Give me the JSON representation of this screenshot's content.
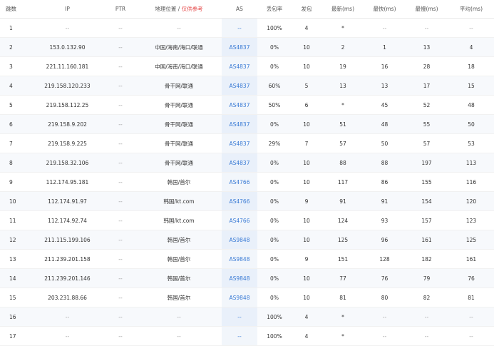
{
  "headers": {
    "hop": "跳数",
    "ip": "IP",
    "ptr": "PTR",
    "geo": "地理位置",
    "geo_sep": " / ",
    "geo_note": "仅供参考",
    "as": "AS",
    "loss": "丢包率",
    "sent": "发包",
    "last": "最新(ms)",
    "best": "最快(ms)",
    "worst": "最慢(ms)",
    "avg": "平均(ms)"
  },
  "rows": [
    {
      "hop": "1",
      "ip": "--",
      "ptr": "--",
      "geo": "--",
      "as": "--",
      "loss": "100%",
      "sent": "4",
      "last": "*",
      "best": "--",
      "worst": "--",
      "avg": "--"
    },
    {
      "hop": "2",
      "ip": "153.0.132.90",
      "ptr": "--",
      "geo": "中国/海南/海口/联通",
      "as": "AS4837",
      "loss": "0%",
      "sent": "10",
      "last": "2",
      "best": "1",
      "worst": "13",
      "avg": "4"
    },
    {
      "hop": "3",
      "ip": "221.11.160.181",
      "ptr": "--",
      "geo": "中国/海南/海口/联通",
      "as": "AS4837",
      "loss": "0%",
      "sent": "10",
      "last": "19",
      "best": "16",
      "worst": "28",
      "avg": "18"
    },
    {
      "hop": "4",
      "ip": "219.158.120.233",
      "ptr": "--",
      "geo": "骨干网/联通",
      "as": "AS4837",
      "loss": "60%",
      "sent": "5",
      "last": "13",
      "best": "13",
      "worst": "17",
      "avg": "15"
    },
    {
      "hop": "5",
      "ip": "219.158.112.25",
      "ptr": "--",
      "geo": "骨干网/联通",
      "as": "AS4837",
      "loss": "50%",
      "sent": "6",
      "last": "*",
      "best": "45",
      "worst": "52",
      "avg": "48"
    },
    {
      "hop": "6",
      "ip": "219.158.9.202",
      "ptr": "--",
      "geo": "骨干网/联通",
      "as": "AS4837",
      "loss": "0%",
      "sent": "10",
      "last": "51",
      "best": "48",
      "worst": "55",
      "avg": "50"
    },
    {
      "hop": "7",
      "ip": "219.158.9.225",
      "ptr": "--",
      "geo": "骨干网/联通",
      "as": "AS4837",
      "loss": "29%",
      "sent": "7",
      "last": "57",
      "best": "50",
      "worst": "57",
      "avg": "53"
    },
    {
      "hop": "8",
      "ip": "219.158.32.106",
      "ptr": "--",
      "geo": "骨干网/联通",
      "as": "AS4837",
      "loss": "0%",
      "sent": "10",
      "last": "88",
      "best": "88",
      "worst": "197",
      "avg": "113"
    },
    {
      "hop": "9",
      "ip": "112.174.95.181",
      "ptr": "--",
      "geo": "韩国/首尔",
      "as": "AS4766",
      "loss": "0%",
      "sent": "10",
      "last": "117",
      "best": "86",
      "worst": "155",
      "avg": "116"
    },
    {
      "hop": "10",
      "ip": "112.174.91.97",
      "ptr": "--",
      "geo": "韩国/kt.com",
      "as": "AS4766",
      "loss": "0%",
      "sent": "9",
      "last": "91",
      "best": "91",
      "worst": "154",
      "avg": "120"
    },
    {
      "hop": "11",
      "ip": "112.174.92.74",
      "ptr": "--",
      "geo": "韩国/kt.com",
      "as": "AS4766",
      "loss": "0%",
      "sent": "10",
      "last": "124",
      "best": "93",
      "worst": "157",
      "avg": "123"
    },
    {
      "hop": "12",
      "ip": "211.115.199.106",
      "ptr": "--",
      "geo": "韩国/首尔",
      "as": "AS9848",
      "loss": "0%",
      "sent": "10",
      "last": "125",
      "best": "96",
      "worst": "161",
      "avg": "125"
    },
    {
      "hop": "13",
      "ip": "211.239.201.158",
      "ptr": "--",
      "geo": "韩国/首尔",
      "as": "AS9848",
      "loss": "0%",
      "sent": "9",
      "last": "151",
      "best": "128",
      "worst": "182",
      "avg": "161"
    },
    {
      "hop": "14",
      "ip": "211.239.201.146",
      "ptr": "--",
      "geo": "韩国/首尔",
      "as": "AS9848",
      "loss": "0%",
      "sent": "10",
      "last": "77",
      "best": "76",
      "worst": "79",
      "avg": "76"
    },
    {
      "hop": "15",
      "ip": "203.231.88.66",
      "ptr": "--",
      "geo": "韩国/首尔",
      "as": "AS9848",
      "loss": "0%",
      "sent": "10",
      "last": "81",
      "best": "80",
      "worst": "82",
      "avg": "81"
    },
    {
      "hop": "16",
      "ip": "--",
      "ptr": "--",
      "geo": "--",
      "as": "--",
      "loss": "100%",
      "sent": "4",
      "last": "*",
      "best": "--",
      "worst": "--",
      "avg": "--"
    },
    {
      "hop": "17",
      "ip": "--",
      "ptr": "--",
      "geo": "--",
      "as": "--",
      "loss": "100%",
      "sent": "4",
      "last": "*",
      "best": "--",
      "worst": "--",
      "avg": "--"
    }
  ],
  "colors": {
    "as_link": "#3a7bd5",
    "geo_note": "#e64a4a",
    "alt_row": "#f7f9fc"
  }
}
